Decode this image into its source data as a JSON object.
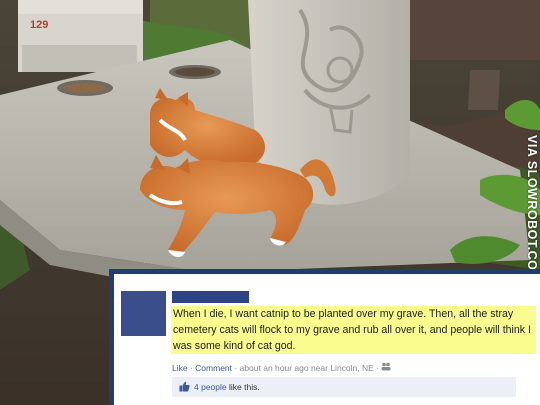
{
  "photo": {
    "stone_number": "129",
    "watermark": "VIA SLOWROBOT.COM"
  },
  "post": {
    "status": "When I die, I want catnip to be planted over my grave. Then, all the stray cemetery cats will flock to my grave and rub all over it, and people will think I was some kind of cat god.",
    "like_link": "Like",
    "comment_link": "Comment",
    "timestamp": "about an hour ago near Lincoln, NE",
    "people_count": "4 people",
    "like_suffix": "like this."
  },
  "colors": {
    "frame": "#223b73",
    "highlight": "#fafd8d",
    "link": "#3b5998"
  }
}
